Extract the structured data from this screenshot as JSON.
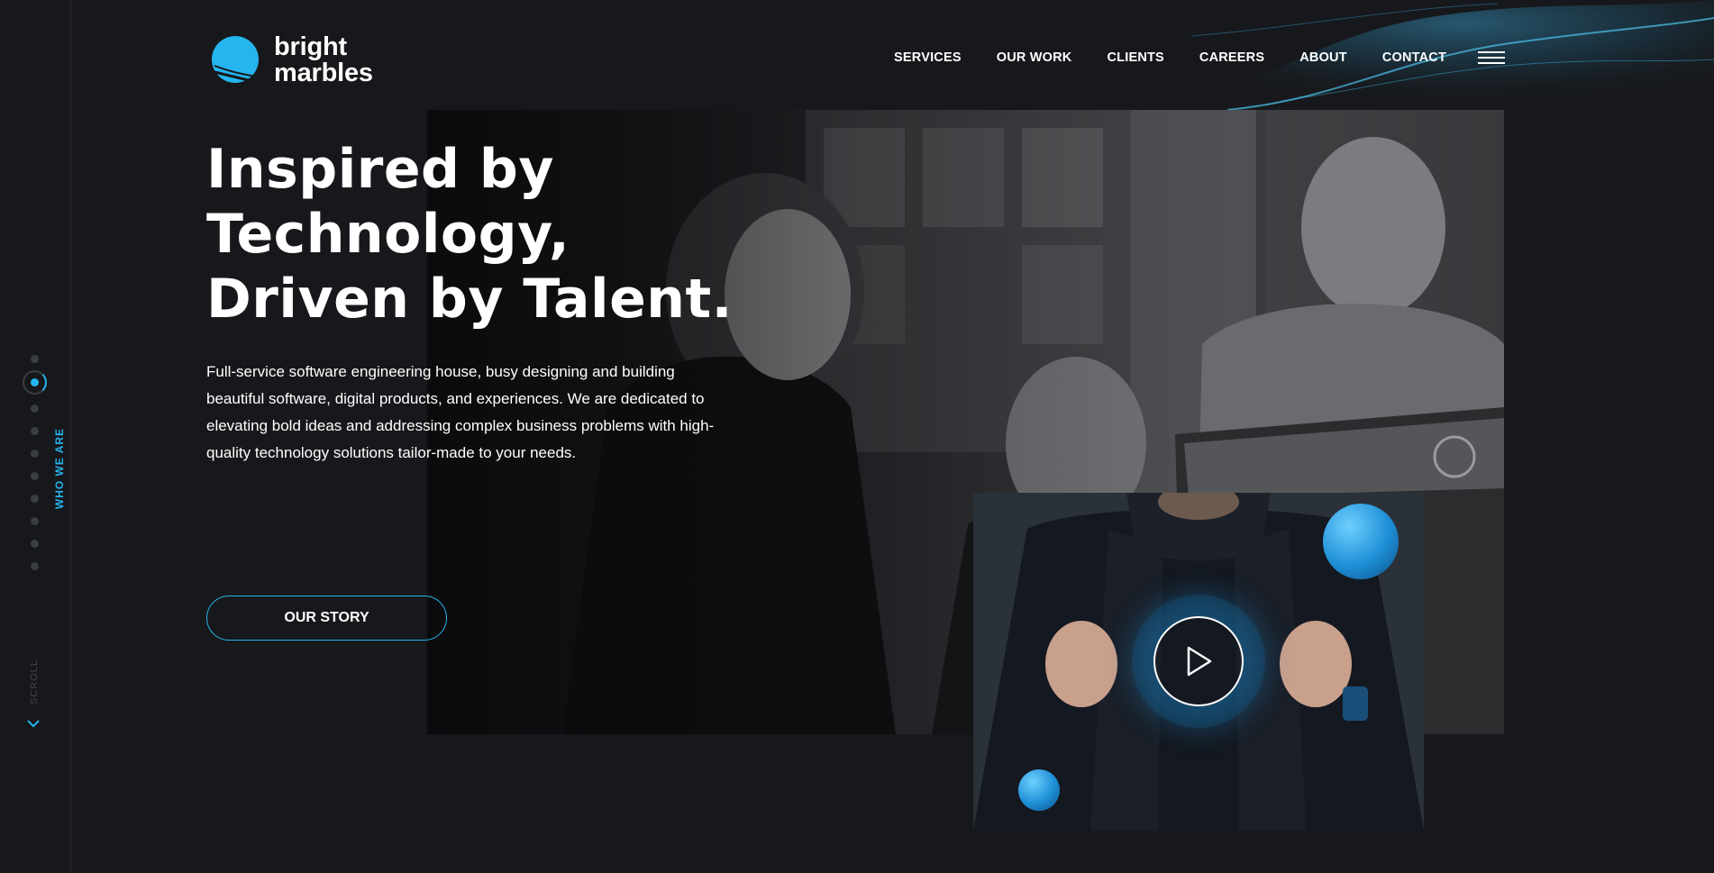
{
  "brand": {
    "line1": "bright",
    "line2": "marbles",
    "accent_color": "#25b5ef"
  },
  "nav": {
    "items": [
      {
        "label": "SERVICES"
      },
      {
        "label": "OUR WORK"
      },
      {
        "label": "CLIENTS"
      },
      {
        "label": "CAREERS"
      },
      {
        "label": "ABOUT"
      },
      {
        "label": "CONTACT"
      }
    ],
    "menu_icon": "hamburger-icon"
  },
  "sidebar": {
    "section_label": "WHO WE ARE",
    "scroll_label": "SCROLL",
    "active_index": 1,
    "dot_count": 10
  },
  "hero": {
    "headline": [
      "Inspired by",
      "Technology,",
      "Driven by Talent."
    ],
    "description": "Full-service software engineering house, busy designing and building beautiful software, digital products, and experiences. We are dedicated to elevating bold ideas and addressing complex business problems with high-quality technology solutions tailor-made to your needs.",
    "cta_label": "OUR STORY"
  },
  "video": {
    "play_icon": "play-icon"
  }
}
